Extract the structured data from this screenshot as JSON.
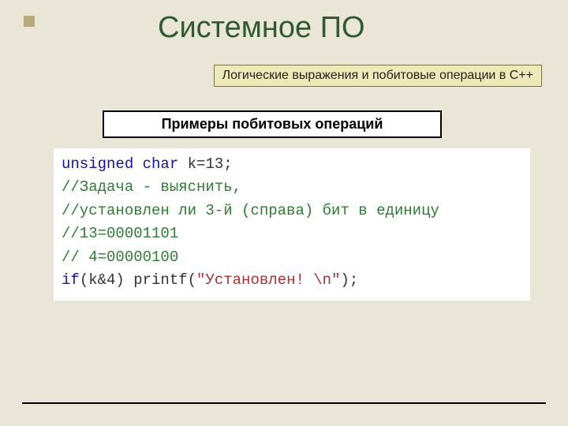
{
  "title": "Системное ПО",
  "subtitle": "Логические выражения и побитовые операции в С++",
  "section_heading": "Примеры побитовых операций",
  "code": {
    "line1_kw1": "unsigned",
    "line1_kw2": "char",
    "line1_rest": " k=13;",
    "cmt2": "//Задача - выяснить,",
    "cmt3": "//установлен ли 3-й (справа) бит в единицу",
    "cmt4": "//13=00001101",
    "cmt5": "// 4=00000100",
    "line6_kw": "if",
    "line6_mid": "(k&4) printf(",
    "line6_str": "\"Установлен! \\n\"",
    "line6_end": ");"
  }
}
